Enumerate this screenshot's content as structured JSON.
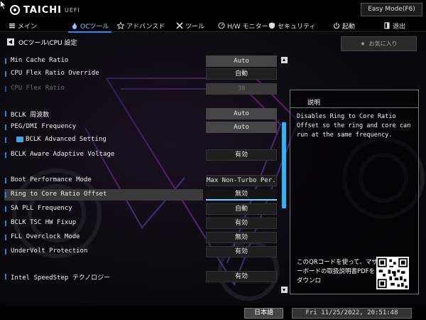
{
  "brand": {
    "logo_text": "TAICHI",
    "logo_sub": "UEFI"
  },
  "mode_button": "Easy Mode(F6)",
  "nav": [
    {
      "label": "メイン",
      "icon": "menu-icon"
    },
    {
      "label": "OCツール",
      "icon": "flame-icon",
      "active": true
    },
    {
      "label": "アドバンスド",
      "icon": "star-icon"
    },
    {
      "label": "ツール",
      "icon": "tools-icon"
    },
    {
      "label": "H/W モニター",
      "icon": "monitor-icon"
    },
    {
      "label": "セキュリティ",
      "icon": "shield-icon"
    },
    {
      "label": "起動",
      "icon": "power-icon"
    },
    {
      "label": "退出",
      "icon": "exit-icon"
    }
  ],
  "breadcrumb": "OCツール\\CPU 設定",
  "favorites_label": "お気に入り",
  "rows": [
    {
      "label": "Min Cache  Ratio",
      "value": "Auto"
    },
    {
      "label": "CPU Flex   Ratio Override",
      "value": "自動"
    },
    {
      "label": "CPU Flex   Ratio",
      "value": "30"
    },
    {
      "label": "BCLK 周波数",
      "value": "Auto"
    },
    {
      "label": "PEG/DMI Frequency",
      "value": "Auto"
    },
    {
      "label": "BCLK Advanced Setting",
      "value": ""
    },
    {
      "label": "BCLK Aware Adaptive Voltage",
      "value": "有効"
    },
    {
      "label": "Boot Performance Mode",
      "value": "Max Non-Turbo Per..."
    },
    {
      "label": "Ring to Core Ratio Offset",
      "value": "無効"
    },
    {
      "label": "SA PLL Frequency",
      "value": "自動"
    },
    {
      "label": "BCLK TSC HW Fixup",
      "value": "有効"
    },
    {
      "label": "FLL Overclock Mode",
      "value": "無効"
    },
    {
      "label": "UnderVolt Protection",
      "value": "有効"
    },
    {
      "label": "Intel SpeedStep テクノロジー",
      "value": "有効"
    }
  ],
  "info": {
    "title": "説明",
    "description": "Disables Ring to Core Ratio Offset so the ring and core can run at the same frequency.",
    "qr_text": "このQRコードを使って、マザーボードの取扱説明書PDFをダウンロ"
  },
  "footer": {
    "language": "日本語",
    "datetime": "Fri 11/25/2022, 20:51:48"
  },
  "colors": {
    "accent": "#29b6f6",
    "nav_active": "#1e90ff",
    "selected_underline": "#6fd3ff"
  }
}
